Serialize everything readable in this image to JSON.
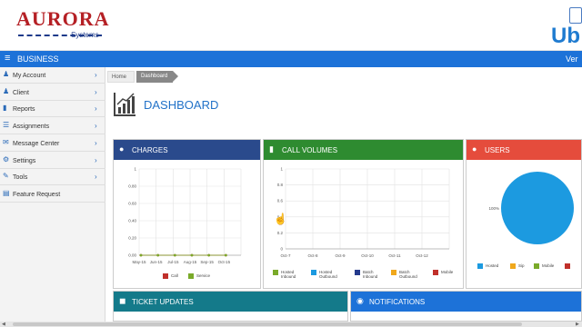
{
  "header": {
    "logo_main": "AURORA",
    "logo_sub": "Systems",
    "right_brand": "Ub"
  },
  "business_bar": {
    "label": "BUSINESS",
    "right_text": "Ver"
  },
  "sidebar": {
    "items": [
      {
        "label": "My Account",
        "icon": "user-icon",
        "chevron": true
      },
      {
        "label": "Client",
        "icon": "users-icon",
        "chevron": true
      },
      {
        "label": "Reports",
        "icon": "bar-chart-icon",
        "chevron": true
      },
      {
        "label": "Assignments",
        "icon": "assignments-icon",
        "chevron": true
      },
      {
        "label": "Message Center",
        "icon": "message-icon",
        "chevron": true
      },
      {
        "label": "Settings",
        "icon": "sliders-icon",
        "chevron": true
      },
      {
        "label": "Tools",
        "icon": "wrench-icon",
        "chevron": true
      },
      {
        "label": "Feature Request",
        "icon": "document-icon",
        "chevron": false
      }
    ]
  },
  "breadcrumb": {
    "home": "Home",
    "current": "Dashboard"
  },
  "page_title": "DASHBOARD",
  "colors": {
    "brand_red": "#b52025",
    "bar_blue": "#1d72d8",
    "charges_header": "#2a4a8c",
    "call_volumes_header": "#2e8b30",
    "users_header": "#e54c3c",
    "ticket_header": "#147a8a",
    "notifications_header": "#1d72d8",
    "pie_blue": "#1c9ae0"
  },
  "panels": {
    "charges": {
      "title": "CHARGES",
      "legend": [
        {
          "label": "Call",
          "color": "#c0302b"
        },
        {
          "label": "Service",
          "color": "#7aaa2a"
        }
      ]
    },
    "call_volumes": {
      "title": "CALL VOLUMES",
      "legend": [
        {
          "label": "Hosted Inbound",
          "color": "#7aaa2a"
        },
        {
          "label": "Hosted Outbound",
          "color": "#1c9ae0"
        },
        {
          "label": "Batch Inbound",
          "color": "#243a8c"
        },
        {
          "label": "Batch Outbound",
          "color": "#f0a81c"
        },
        {
          "label": "Mobile",
          "color": "#c0302b"
        }
      ]
    },
    "users": {
      "title": "USERS",
      "pie_label": "100%",
      "legend": [
        {
          "label": "Hosted",
          "color": "#1c9ae0"
        },
        {
          "label": "Sip",
          "color": "#f0a81c"
        },
        {
          "label": "Mobile",
          "color": "#7aaa2a"
        },
        {
          "label": "",
          "color": "#c0302b"
        }
      ]
    },
    "ticket_updates": {
      "title": "TICKET UPDATES"
    },
    "notifications": {
      "title": "NOTIFICATIONS"
    }
  },
  "chart_data": [
    {
      "type": "line",
      "title": "CHARGES",
      "x": [
        "May-15",
        "Jun-15",
        "Jul-15",
        "Aug-15",
        "Sep-15",
        "Oct-15"
      ],
      "series": [
        {
          "name": "Call",
          "values": [
            0,
            0,
            0,
            0,
            0,
            0
          ]
        },
        {
          "name": "Service",
          "values": [
            0,
            0,
            0,
            0,
            0,
            0
          ]
        }
      ],
      "yticks": [
        "0.00",
        "0.20",
        "0.40",
        "0.60",
        "0.80",
        "1"
      ],
      "ylim": [
        0,
        1
      ],
      "grid": true,
      "legend_position": "bottom"
    },
    {
      "type": "line",
      "title": "CALL VOLUMES",
      "x": [
        "Oct-7",
        "Oct-8",
        "Oct-9",
        "Oct-10",
        "Oct-11",
        "Oct-12"
      ],
      "series": [
        {
          "name": "Hosted Inbound",
          "values": []
        },
        {
          "name": "Hosted Outbound",
          "values": []
        },
        {
          "name": "Batch Inbound",
          "values": []
        },
        {
          "name": "Batch Outbound",
          "values": []
        },
        {
          "name": "Mobile",
          "values": []
        }
      ],
      "yticks": [
        "0",
        "0.2",
        "0.4",
        "0.6",
        "0.8",
        "1"
      ],
      "ylim": [
        0,
        1
      ],
      "grid": true,
      "legend_position": "bottom"
    },
    {
      "type": "pie",
      "title": "USERS",
      "categories": [
        "Hosted",
        "Sip",
        "Mobile"
      ],
      "values": [
        100,
        0,
        0
      ],
      "data_labels": [
        "100%"
      ],
      "legend_position": "bottom"
    }
  ]
}
